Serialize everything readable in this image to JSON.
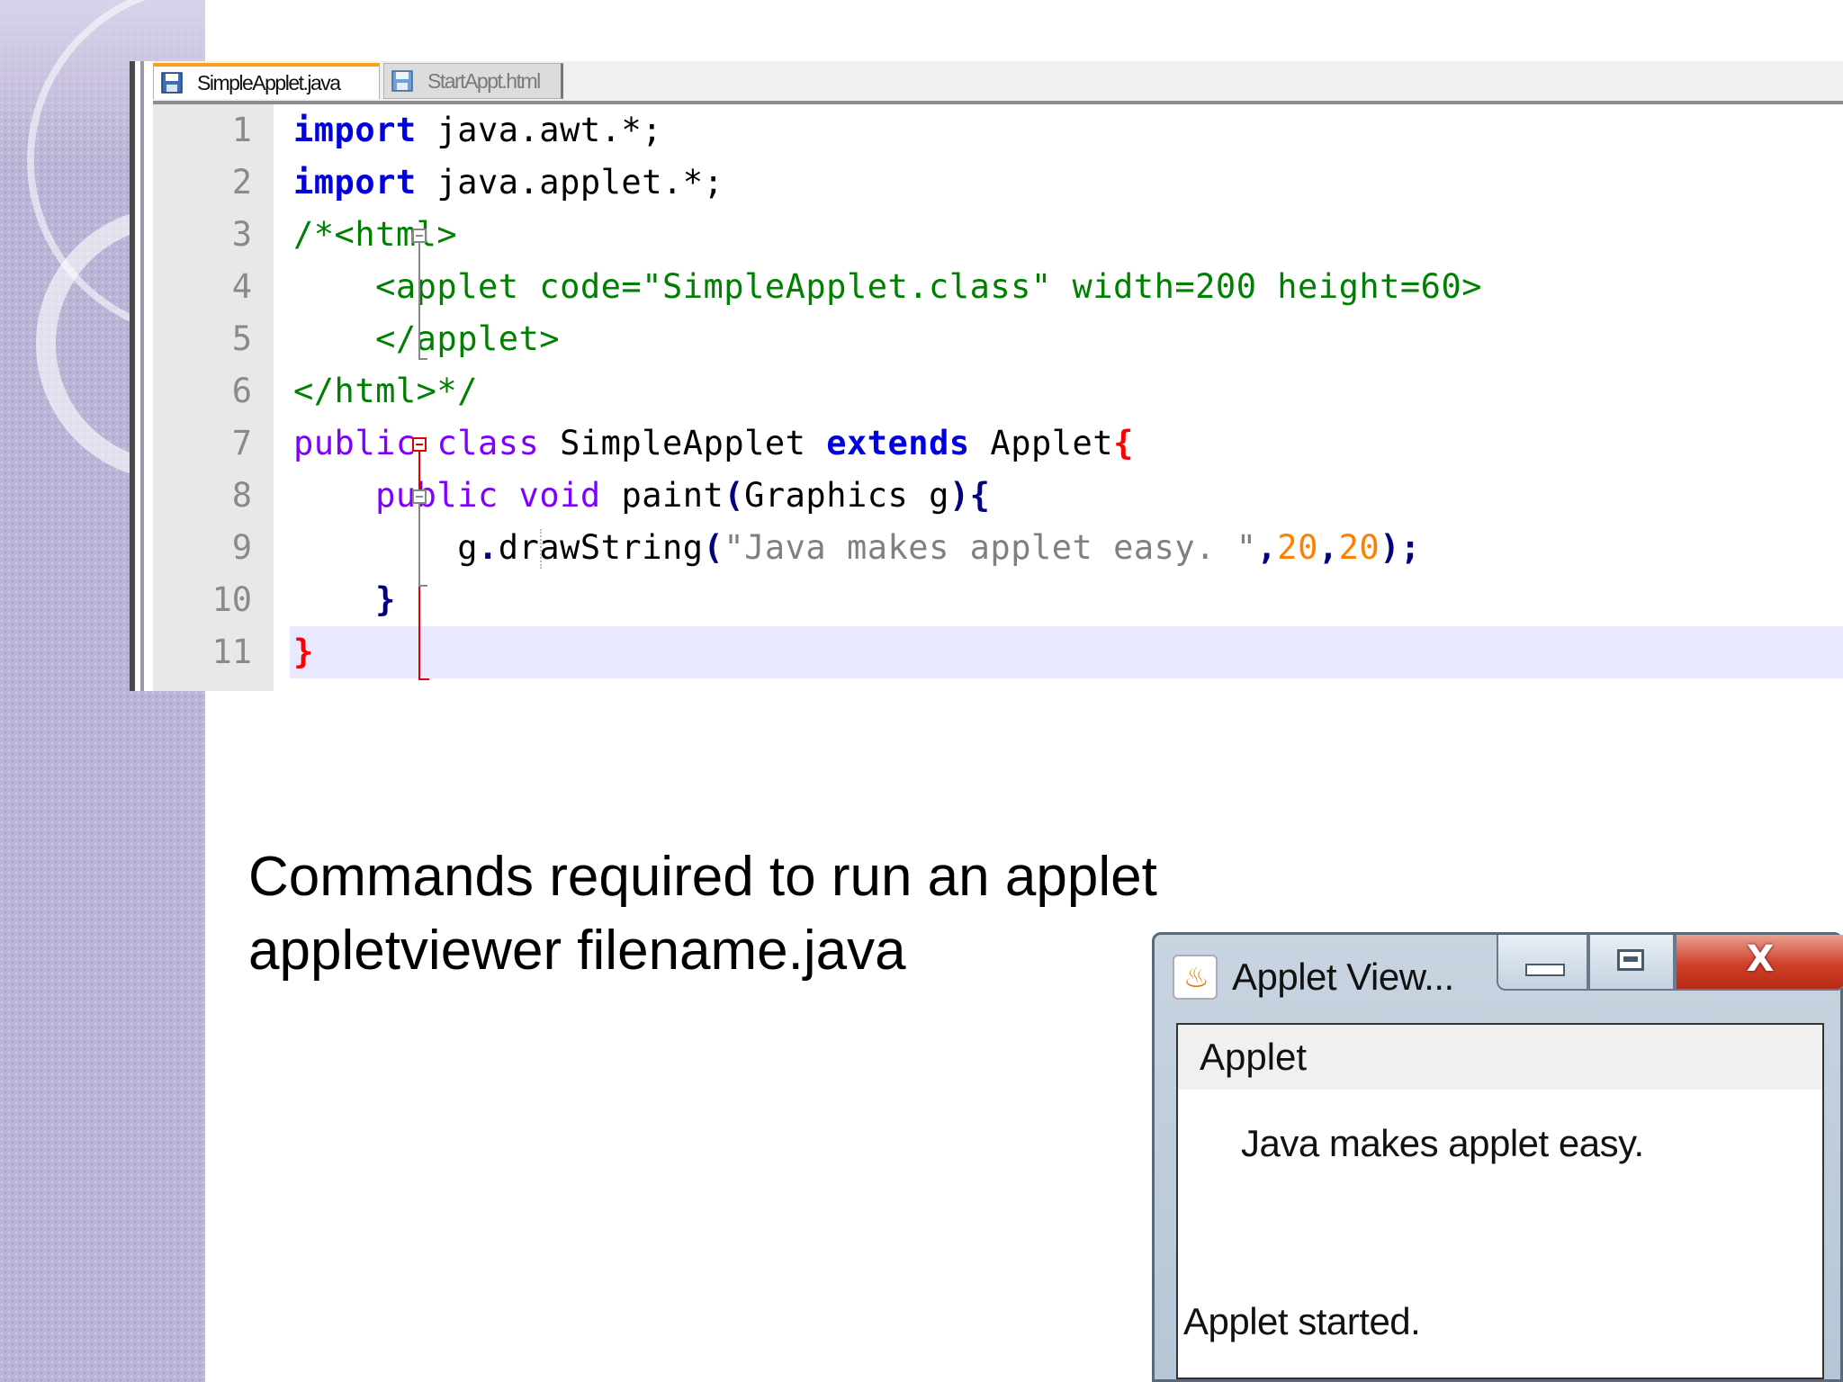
{
  "editor": {
    "tabs": [
      {
        "label": "SimpleApplet.java",
        "active": true
      },
      {
        "label": "StartAppt.html",
        "active": false
      }
    ],
    "line_numbers": [
      "1",
      "2",
      "3",
      "4",
      "5",
      "6",
      "7",
      "8",
      "9",
      "10",
      "11"
    ],
    "code": {
      "l1": {
        "kw": "import",
        "rest": " java.awt.*;"
      },
      "l2": {
        "kw": "import",
        "rest": " java.applet.*;"
      },
      "l3": {
        "text": "/*<html>"
      },
      "l4": {
        "text": "    <applet code=\"SimpleApplet.class\" width=200 height=60>"
      },
      "l5": {
        "text": "    </applet>"
      },
      "l6": {
        "text": "</html>*/"
      },
      "l7": {
        "public": "public",
        "class": "class",
        "name": "SimpleApplet",
        "extends": "extends",
        "base": "Applet",
        "brace": "{"
      },
      "l8": {
        "indent": "    ",
        "public": "public",
        "void": "void",
        "method": "paint",
        "paren_open": "(",
        "params": "Graphics g",
        "paren_close": ")",
        "brace": "{"
      },
      "l9": {
        "indent": "        ",
        "obj": "g",
        "dot": ".",
        "call": "drawString",
        "paren_open": "(",
        "string": "\"Java makes applet easy. \"",
        "comma1": ",",
        "n1": "20",
        "comma2": ",",
        "n2": "20",
        "paren_close": ")",
        "semi": ";"
      },
      "l10": {
        "text": "    }"
      },
      "l11": {
        "text": "}"
      }
    }
  },
  "caption": {
    "line1": "Commands required to run an applet",
    "line2": "appletviewer filename.java"
  },
  "applet_viewer": {
    "title": "Applet View...",
    "menu": "Applet",
    "message": "Java makes applet easy.",
    "status": "Applet started.",
    "close_glyph": "X"
  },
  "colors": {
    "keyword": "#0000e0",
    "type_keyword": "#8000ff",
    "comment": "#008000",
    "string": "#808080",
    "number": "#ff8000",
    "brace_match": "#ff0000",
    "current_line": "#e8e8ff",
    "side_band": "#bcb4d6"
  },
  "icons": {
    "tab_icon": "save-disk-icon",
    "window_icon": "java-cup-icon",
    "minimize": "minimize-icon",
    "maximize": "maximize-icon",
    "close": "close-icon"
  }
}
